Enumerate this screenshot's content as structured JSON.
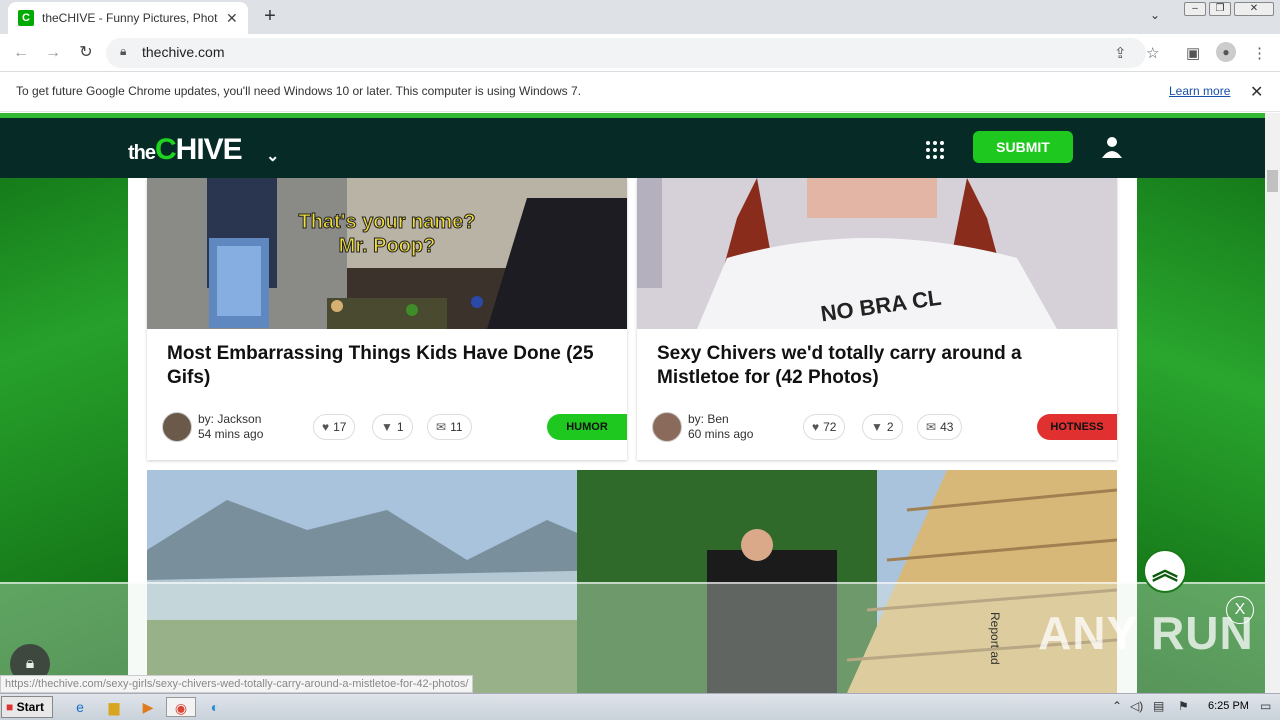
{
  "browser": {
    "tab_title": "theCHIVE - Funny Pictures, Photos, Memes & Videos",
    "tab_favicon_letter": "C",
    "new_tab_symbol": "+",
    "url": "thechive.com",
    "infobar_text": "To get future Google Chrome updates, you'll need Windows 10 or later. This computer is using Windows 7.",
    "infobar_link": "Learn more"
  },
  "site": {
    "logo_the": "the",
    "logo_c": "C",
    "logo_rest": "HIVE",
    "submit_label": "SUBMIT",
    "brand_green": "#1ec81e",
    "header_bg": "#062b27"
  },
  "cards": [
    {
      "title": "Most Embarrassing Things Kids Have Done (25 Gifs)",
      "image_caption_line1": "That's your name?",
      "image_caption_line2": "Mr. Poop?",
      "author": "by: Jackson",
      "time": "54 mins ago",
      "likes": "17",
      "dislikes": "1",
      "comments": "11",
      "tag": "HUMOR",
      "tag_color": "#1ec81e"
    },
    {
      "title": "Sexy Chivers we'd totally carry around a Mistletoe for (42 Photos)",
      "image_shirt_text": "NO BRA CL",
      "author": "by: Ben",
      "time": "60 mins ago",
      "likes": "72",
      "dislikes": "2",
      "comments": "43",
      "tag": "HOTNESS",
      "tag_color": "#e03030"
    }
  ],
  "overlay": {
    "report_ad": "Report ad",
    "close_symbol": "X",
    "watermark": "ANY RUN",
    "status_url": "https://thechive.com/sexy-girls/sexy-chivers-wed-totally-carry-around-a-mistletoe-for-42-photos/"
  },
  "taskbar": {
    "start_label": "Start",
    "clock": "6:25 PM"
  }
}
